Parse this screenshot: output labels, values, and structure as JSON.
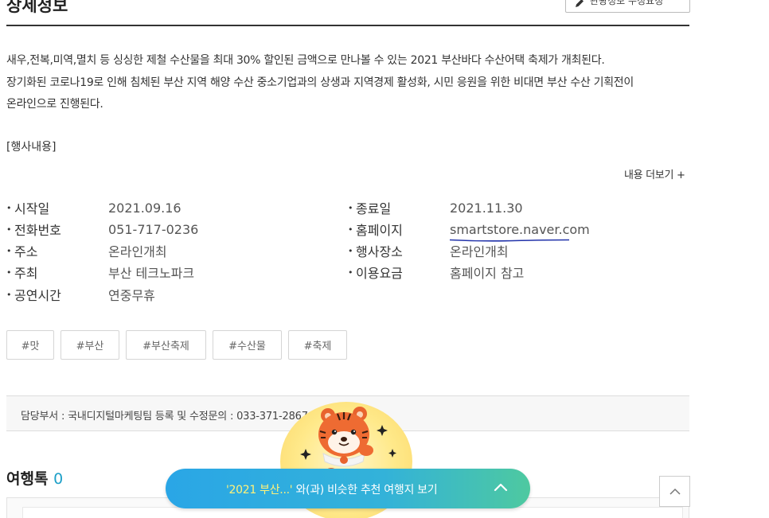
{
  "page": {
    "title": "상세정보",
    "edit_button_label": "관광정보 수정요청"
  },
  "description": {
    "lines": [
      "새우,전복,미역,멸치 등 싱싱한 제철 수산물을 최대 30% 할인된 금액으로 만나볼 수 있는 2021 부산바다 수산어택 축제가 개최된다.",
      "장기화된 코로나19로 인해 침체된 부산 지역 해양 수산 중소기업과의 상생과 지역경제 활성화, 시민 응원을 위한 비대면 부산 수산 기획전이",
      "온라인으로 진행된다."
    ],
    "event_heading": "[행사내용]"
  },
  "more_link": "내용 더보기 +",
  "info": {
    "left": [
      {
        "label": "시작일",
        "value": "2021.09.16"
      },
      {
        "label": "전화번호",
        "value": "051-717-0236"
      },
      {
        "label": "주소",
        "value": "온라인개최"
      },
      {
        "label": "주최",
        "value": "부산 테크노파크"
      },
      {
        "label": "공연시간",
        "value": "연중무휴"
      }
    ],
    "right": [
      {
        "label": "종료일",
        "value": "2021.11.30"
      },
      {
        "label": "홈페이지",
        "value": "smartstore.naver.com"
      },
      {
        "label": "행사장소",
        "value": "온라인개최"
      },
      {
        "label": "이용요금",
        "value": "홈페이지 참고"
      }
    ]
  },
  "tags": [
    "#맛",
    "#부산",
    "#부산축제",
    "#수산물",
    "#축제"
  ],
  "department": {
    "text": "담당부서 : 국내디지털마케팅팀   등록 및 수정문의 : 033-371-2867"
  },
  "travel_talk": {
    "title": "여행톡",
    "count": "0"
  },
  "recommend": {
    "highlight": "'2021 부산...'",
    "text": " 와(과) 비슷한 추천 여행지 보기"
  },
  "colors": {
    "accent": "#1ea0c8",
    "rec_gradient_start": "#2aa6e6",
    "rec_gradient_end": "#4ec9a0",
    "link_underline": "#2233aa"
  },
  "icons": {
    "edit": "pencil-icon",
    "recommend_toggle": "chevron-up-icon",
    "scroll_top": "chevron-up-icon",
    "mascot": "tiger-mascot"
  }
}
